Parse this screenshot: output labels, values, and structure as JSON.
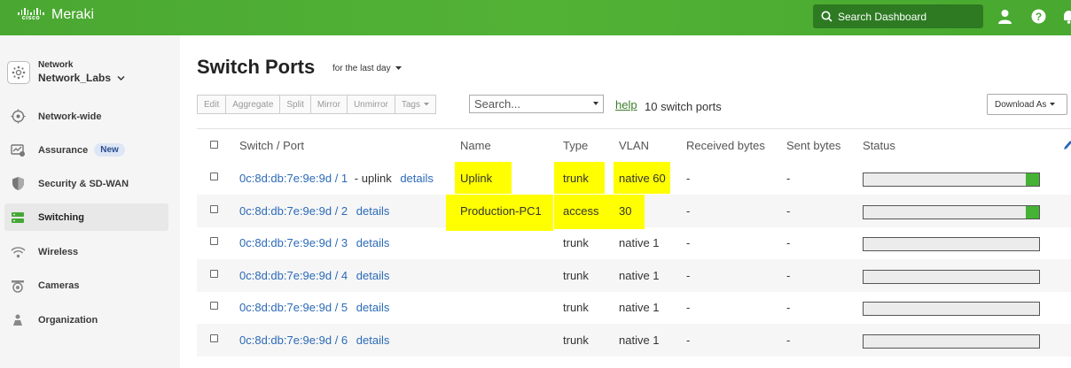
{
  "header": {
    "brand_small": "cisco",
    "brand": "Meraki",
    "search_placeholder": "Search Dashboard",
    "accent": "#52b236"
  },
  "sidebar": {
    "network_label": "Network",
    "network_name": "Network_Labs",
    "items": [
      {
        "label": "Network-wide",
        "icon": "network-wide-icon"
      },
      {
        "label": "Assurance",
        "icon": "assurance-icon",
        "badge": "New"
      },
      {
        "label": "Security & SD-WAN",
        "icon": "shield-icon"
      },
      {
        "label": "Switching",
        "icon": "switch-icon",
        "active": true
      },
      {
        "label": "Wireless",
        "icon": "wifi-icon"
      },
      {
        "label": "Cameras",
        "icon": "camera-icon"
      },
      {
        "label": "Organization",
        "icon": "organization-icon"
      }
    ]
  },
  "main": {
    "title": "Switch Ports",
    "period": "for the last day",
    "toolbar": [
      "Edit",
      "Aggregate",
      "Split",
      "Mirror",
      "Unmirror",
      "Tags"
    ],
    "search_value": "Search...",
    "help": "help",
    "count": "10 switch ports",
    "download": "Download As"
  },
  "table": {
    "columns": [
      "Switch / Port",
      "Name",
      "Type",
      "VLAN",
      "Received bytes",
      "Sent bytes",
      "Status"
    ],
    "rows": [
      {
        "port": "0c:8d:db:7e:9e:9d / 1",
        "extra": "- uplink",
        "details": "details",
        "name": "Uplink",
        "type": "trunk",
        "vlan": "native 60",
        "received": "-",
        "sent": "-",
        "status_active": true
      },
      {
        "port": "0c:8d:db:7e:9e:9d / 2",
        "extra": "",
        "details": "details",
        "name": "Production-PC1",
        "type": "access",
        "vlan": "30",
        "received": "-",
        "sent": "-",
        "status_active": true
      },
      {
        "port": "0c:8d:db:7e:9e:9d / 3",
        "extra": "",
        "details": "details",
        "name": "",
        "type": "trunk",
        "vlan": "native 1",
        "received": "-",
        "sent": "-",
        "status_active": false
      },
      {
        "port": "0c:8d:db:7e:9e:9d / 4",
        "extra": "",
        "details": "details",
        "name": "",
        "type": "trunk",
        "vlan": "native 1",
        "received": "-",
        "sent": "-",
        "status_active": false
      },
      {
        "port": "0c:8d:db:7e:9e:9d / 5",
        "extra": "",
        "details": "details",
        "name": "",
        "type": "trunk",
        "vlan": "native 1",
        "received": "-",
        "sent": "-",
        "status_active": false
      },
      {
        "port": "0c:8d:db:7e:9e:9d / 6",
        "extra": "",
        "details": "details",
        "name": "",
        "type": "trunk",
        "vlan": "native 1",
        "received": "-",
        "sent": "-",
        "status_active": false
      }
    ]
  }
}
